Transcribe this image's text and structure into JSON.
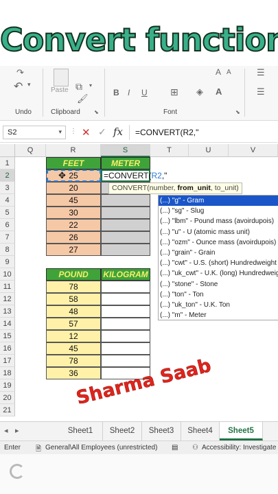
{
  "title_overlay": "Convert function",
  "watermark": "Sharma Saab",
  "ribbon": {
    "undo_label": "Undo",
    "clipboard_label": "Clipboard",
    "paste_label": "Paste",
    "font_label": "Font",
    "font_buttons": [
      "B",
      "I",
      "U"
    ],
    "font_size_buttons": [
      "A",
      "A"
    ]
  },
  "formula_bar": {
    "name_box": "S2",
    "formula": "=CONVERT(R2,\""
  },
  "columns": [
    "Q",
    "R",
    "S",
    "T",
    "U",
    "V"
  ],
  "rows": [
    "1",
    "2",
    "3",
    "4",
    "5",
    "6",
    "7",
    "8",
    "9",
    "10",
    "11",
    "12",
    "13",
    "14",
    "15",
    "16",
    "17",
    "18",
    "19",
    "20",
    "21"
  ],
  "table1": {
    "header_feet": "FEET",
    "header_meter": "METER",
    "feet_values": [
      "25",
      "20",
      "45",
      "30",
      "22",
      "26",
      "27"
    ],
    "editing_text": "=CONVERT(",
    "editing_ref": "R2",
    "editing_tail": ",\""
  },
  "table2": {
    "header_pound": "POUND",
    "header_kilogram": "KILOGRAM",
    "pound_values": [
      "78",
      "58",
      "48",
      "57",
      "12",
      "45",
      "78",
      "36"
    ]
  },
  "tooltip": {
    "prefix": "CONVERT(number, ",
    "bold_arg": "from_unit",
    "suffix": ", to_unit)"
  },
  "dropdown_items": [
    "(...) \"g\" - Gram",
    "(...) \"sg\" - Slug",
    "(...) \"lbm\" - Pound mass (avoirdupois)",
    "(...) \"u\" - U (atomic mass unit)",
    "(...) \"ozm\" - Ounce mass (avoirdupois)",
    "(...) \"grain\" - Grain",
    "(...) \"cwt\" - U.S. (short) Hundredweight",
    "(...) \"uk_cwt\" - U.K. (long) Hundredweight",
    "(...) \"stone\" - Stone",
    "(...) \"ton\" - Ton",
    "(...) \"uk_ton\" - U.K. Ton",
    "(...) \"m\" - Meter"
  ],
  "sheet_tabs": [
    "Sheet1",
    "Sheet2",
    "Sheet3",
    "Sheet4",
    "Sheet5"
  ],
  "active_sheet": "Sheet5",
  "status_bar": {
    "mode": "Enter",
    "sensitivity": "General\\All Employees (unrestricted)",
    "accessibility": "Accessibility: Investigate"
  },
  "colors": {
    "title_fill": "#39b08a",
    "header_green": "#3fa33a",
    "header_text": "#f6f06a",
    "feet_fill": "#f5c8a6",
    "meter_fill": "#d0d0d0",
    "pound_fill": "#fff1a8",
    "highlight": "#1a56c8",
    "watermark": "#e0241b"
  }
}
